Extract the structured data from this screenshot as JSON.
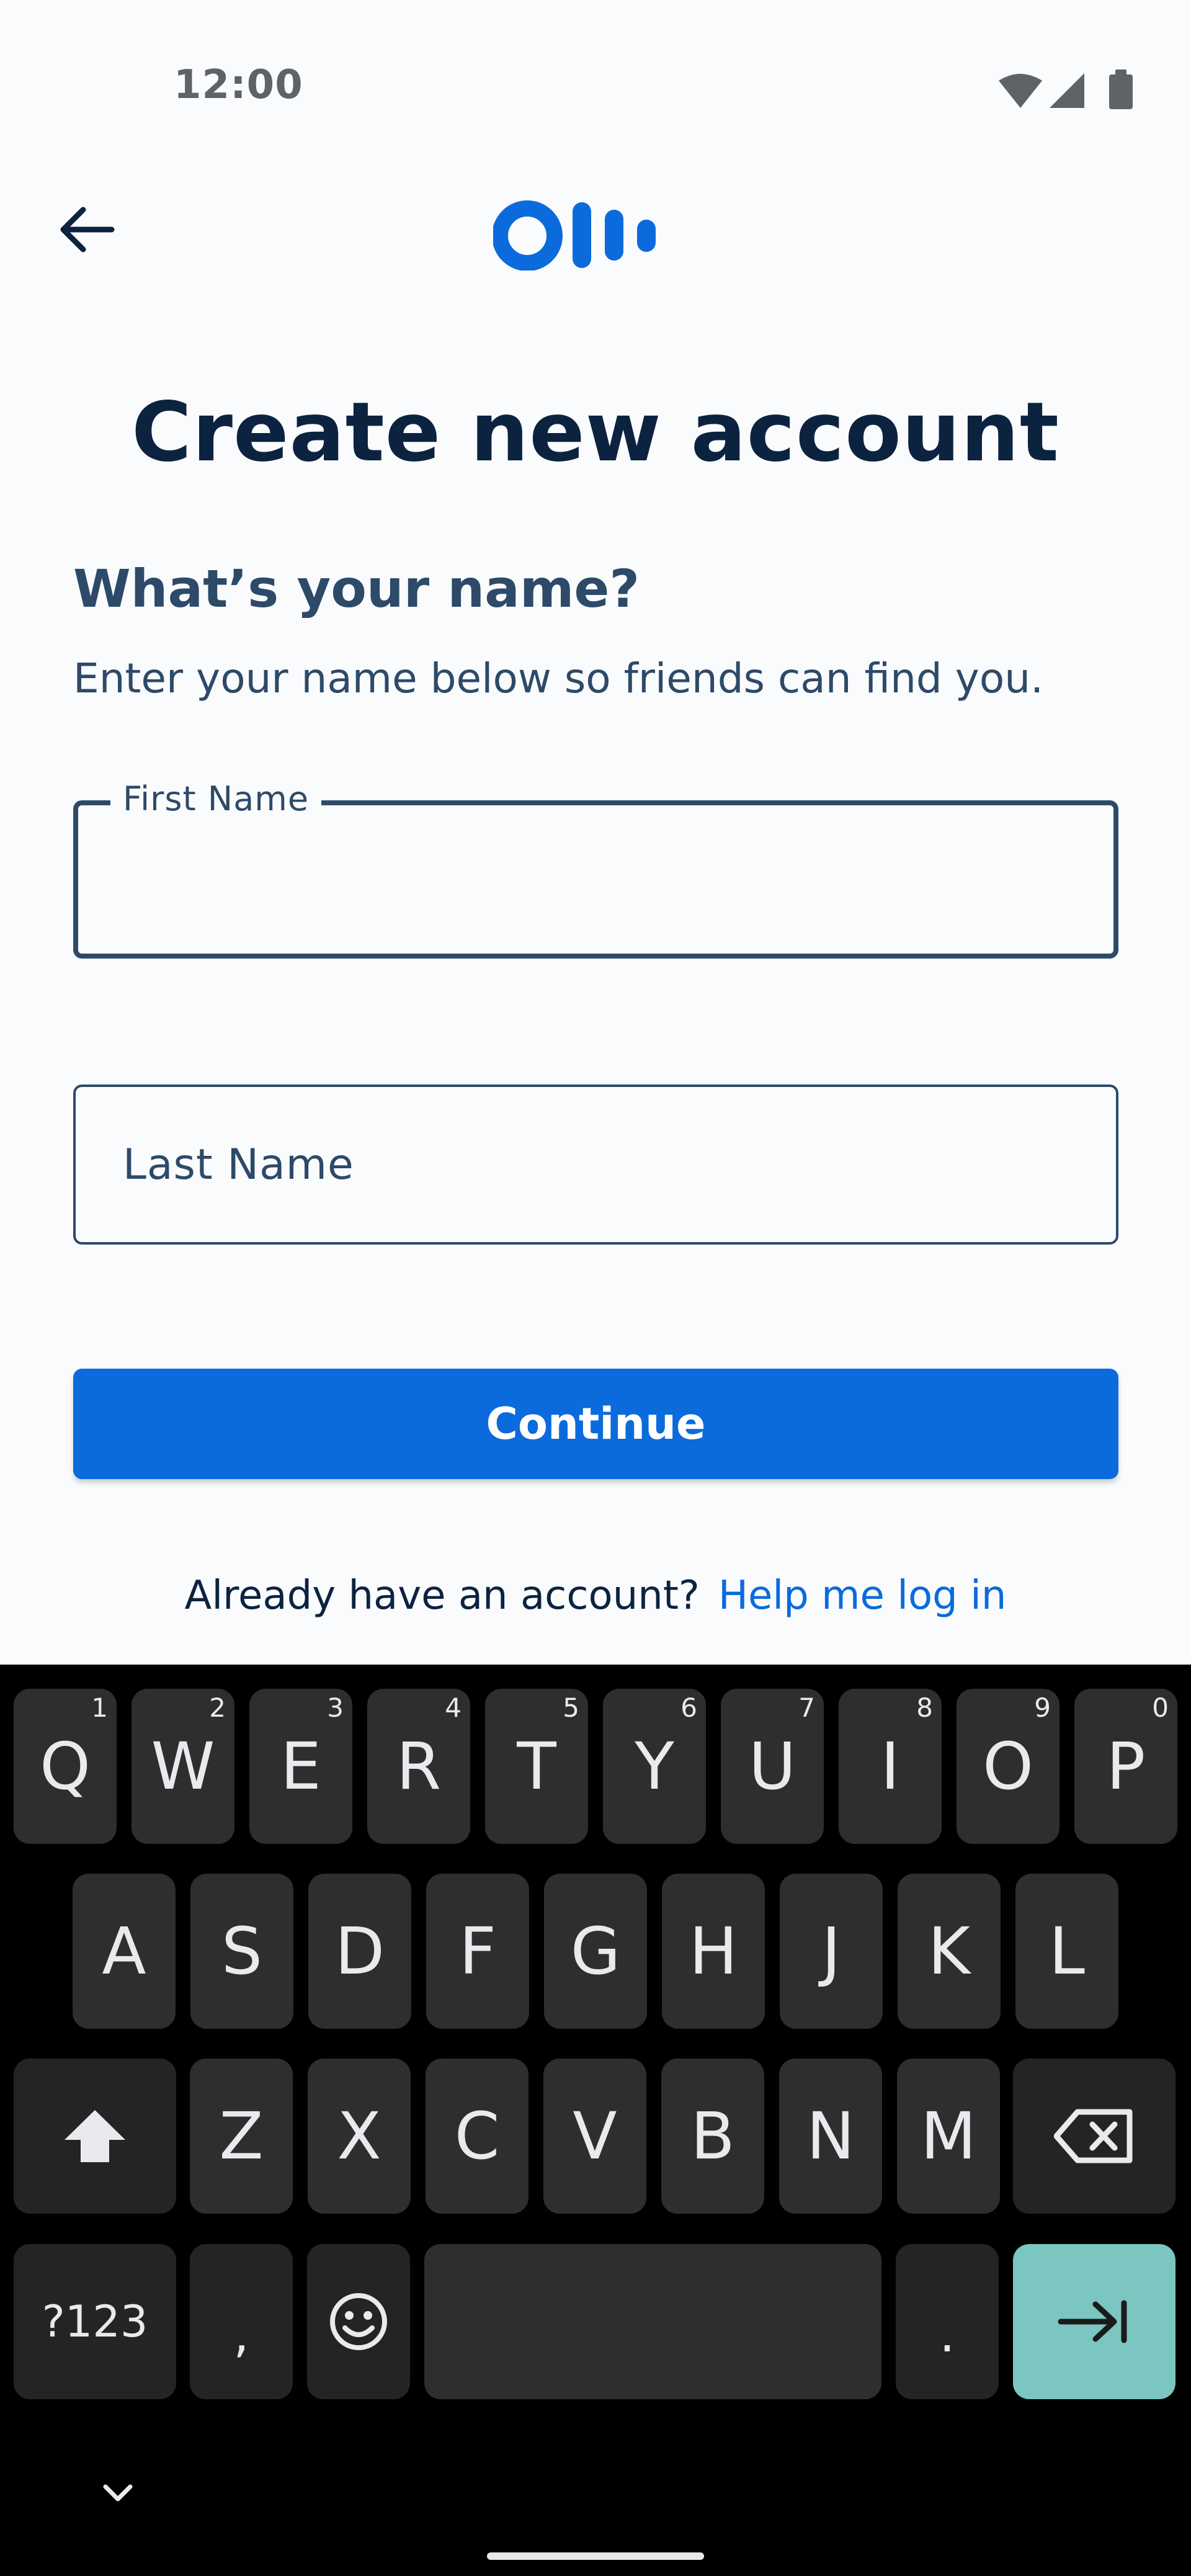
{
  "status_bar": {
    "time": "12:00"
  },
  "header": {
    "logo": "Otter logo"
  },
  "page": {
    "title": "Create new account",
    "question": "What’s your name?",
    "subtitle": "Enter your name below so friends can find you."
  },
  "form": {
    "first_name_label": "First Name",
    "first_name_value": "",
    "last_name_placeholder": "Last Name",
    "continue_label": "Continue"
  },
  "login": {
    "prompt": "Already have an account?",
    "link": "Help me log in"
  },
  "keyboard": {
    "row1": [
      {
        "ch": "Q",
        "num": "1"
      },
      {
        "ch": "W",
        "num": "2"
      },
      {
        "ch": "E",
        "num": "3"
      },
      {
        "ch": "R",
        "num": "4"
      },
      {
        "ch": "T",
        "num": "5"
      },
      {
        "ch": "Y",
        "num": "6"
      },
      {
        "ch": "U",
        "num": "7"
      },
      {
        "ch": "I",
        "num": "8"
      },
      {
        "ch": "O",
        "num": "9"
      },
      {
        "ch": "P",
        "num": "0"
      }
    ],
    "row2": [
      "A",
      "S",
      "D",
      "F",
      "G",
      "H",
      "J",
      "K",
      "L"
    ],
    "row3": [
      "Z",
      "X",
      "C",
      "V",
      "B",
      "N",
      "M"
    ],
    "symbols_label": "?123",
    "comma": ",",
    "period": ".",
    "accent_color": "#7bc6c1"
  },
  "colors": {
    "brand_blue": "#0b6bdc",
    "navy": "#0c2340",
    "slate": "#2d4a68"
  }
}
